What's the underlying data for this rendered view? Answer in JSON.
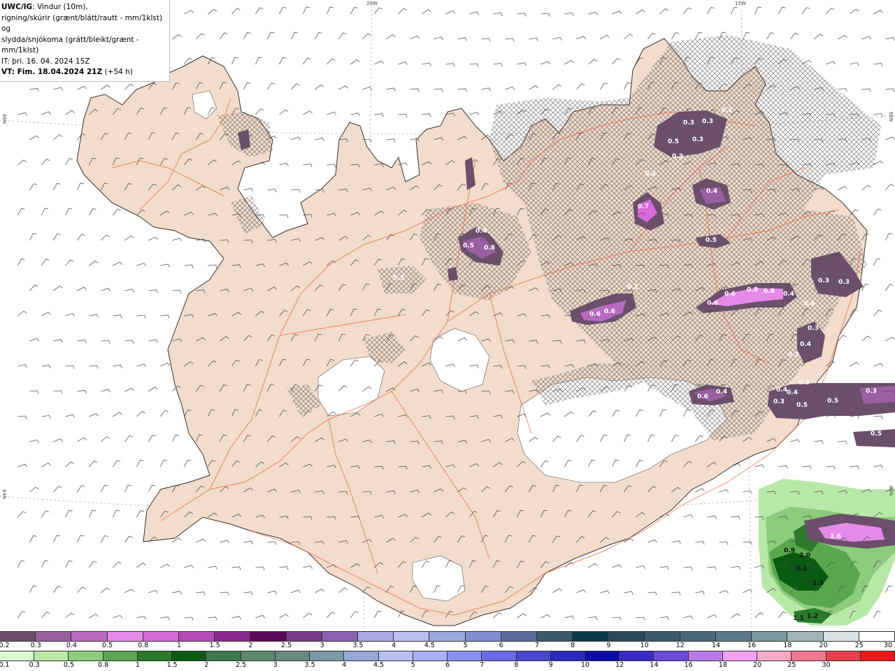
{
  "title": {
    "product": "UWC/IG",
    "desc_line1": ": Vindur (10m),",
    "desc_line2": "rigning/skúrir (grænt/blátt/rautt - mm/1klst) og",
    "desc_line3": "slydda/snjókoma (grátt/bleikt/grænt - mm/1klst)",
    "issue_time": "IT: þri. 16. 04. 2024 15Z",
    "valid_time": "VT: Fim. 18.04.2024 21Z",
    "lead": "(+54 h)"
  },
  "grid_labels": {
    "lon_20w": "20W",
    "lon_15w": "15W",
    "lat_66n_left": "66N",
    "lat_66n_right": "66N",
    "lat_64n_left": "64N",
    "lat_64n_right": "64N"
  },
  "precip_values": [
    "0.3",
    "0.3",
    "0.5",
    "0.3",
    "0.3",
    "0.2",
    "0.2",
    "0.4",
    "0.7",
    "0.5",
    "0.4",
    "0.5",
    "0.8",
    "0.3",
    "0.2",
    "0.6",
    "0.6",
    "0.6",
    "0.6",
    "0.8",
    "0.8",
    "0.4",
    "0.4",
    "0.3",
    "0.3",
    "0.3",
    "0.4",
    "0.3",
    "0.6",
    "0.4",
    "0.4",
    "0.4",
    "0.3",
    "0.5",
    "0.3",
    "0.5",
    "0.3",
    "0.5",
    "1.6",
    "0.9",
    "2.0",
    "3.1",
    "1.5",
    "1.1",
    "1.2"
  ],
  "legend_snow": {
    "colors": [
      "#6b4f6b",
      "#9a5fa0",
      "#b86ac2",
      "#e58ae8",
      "#d86ad8",
      "#b84ab8",
      "#8a2a8a",
      "#5a0a5a",
      "#7a3a8a",
      "#8a60b0",
      "#a6a8e6",
      "#b9c0ee",
      "#9aa8e0",
      "#7f8fd0",
      "#5a6a9a",
      "#3a5a6a",
      "#0a3a4a",
      "#2a4a5a",
      "#3a5a6a",
      "#4a6a7a",
      "#5a7a8a",
      "#7a9aa0",
      "#9fb4b8",
      "#d8e0e4",
      "#ffffff"
    ],
    "labels": [
      "0.2",
      "0.3",
      "0.4",
      "0.5",
      "0.8",
      "1",
      "1.5",
      "2",
      "2.5",
      "3",
      "3.5",
      "4",
      "4.5",
      "5",
      "6",
      "7",
      "8",
      "9",
      "10",
      "12",
      "14",
      "16",
      "18",
      "20",
      "25",
      "30"
    ]
  },
  "legend_rain": {
    "colors": [
      "#d8f8d0",
      "#b8e8a8",
      "#8ccc7c",
      "#5aa84e",
      "#2a7a2a",
      "#0a5a12",
      "#3a7a4a",
      "#5a8a6a",
      "#6a8a80",
      "#7a9aa8",
      "#96a8d8",
      "#b8c0f0",
      "#a8b0f8",
      "#8890f0",
      "#6a6ae8",
      "#4848d0",
      "#2a2ac0",
      "#0a0aa8",
      "#3a2ac8",
      "#6a4ad8",
      "#b87ae8",
      "#f0a0f0",
      "#f8a8c8",
      "#f07890",
      "#e84050",
      "#f01818"
    ],
    "labels": [
      "0.1",
      "0.3",
      "0.5",
      "0.8",
      "1",
      "1.5",
      "2",
      "2.5",
      "3",
      "3.5",
      "4",
      "4.5",
      "5",
      "6",
      "7",
      "8",
      "9",
      "10",
      "12",
      "14",
      "16",
      "18",
      "20",
      "25",
      "30"
    ]
  }
}
